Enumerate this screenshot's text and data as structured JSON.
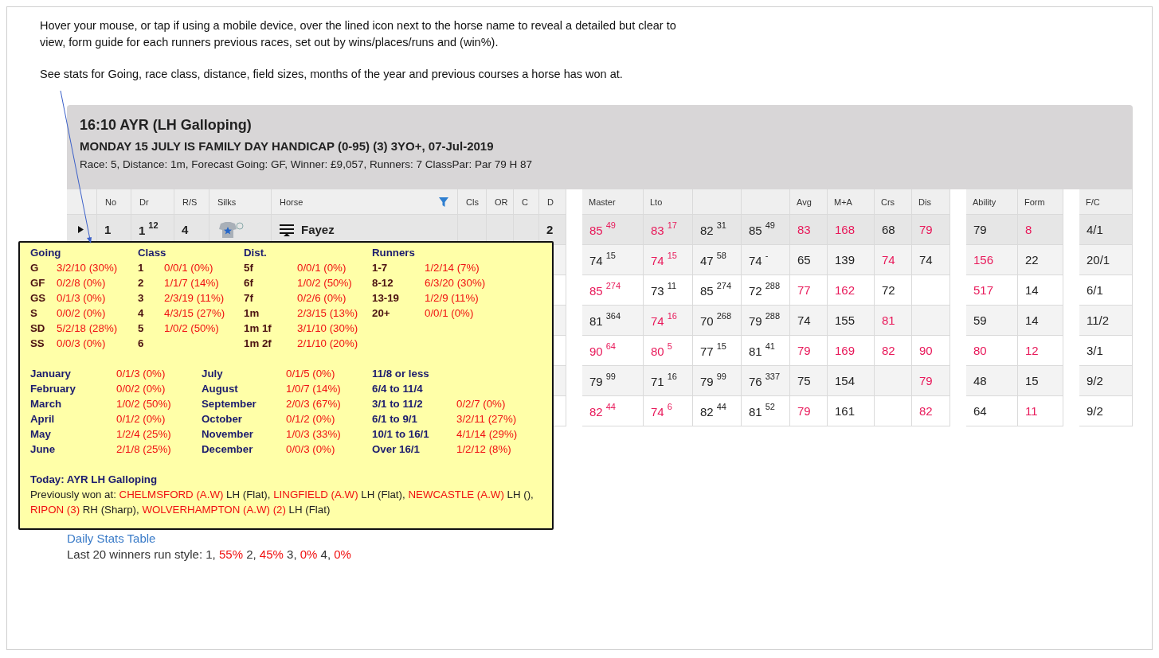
{
  "intro": [
    "Hover your mouse, or tap if using a mobile device, over the lined icon next to the horse name to reveal a detailed but clear to view, form guide for each runners previous races, set out by wins/places/runs and (win%).",
    "See stats for Going, race class, distance, field sizes, months of the year and previous courses a horse has won at."
  ],
  "race": {
    "title": "16:10 AYR (LH Galloping)",
    "name": "MONDAY 15 JULY IS FAMILY DAY HANDICAP (0-95) (3) 3YO+, 07-Jul-2019",
    "details": "Race: 5,  Distance: 1m,  Forecast Going: GF,  Winner: £9,057,  Runners: 7  ClassPar: Par 79 H 87"
  },
  "table": {
    "left_columns": [
      "No",
      "Dr",
      "R/S",
      "Silks",
      "Horse",
      "Cls",
      "OR",
      "C",
      "D"
    ],
    "right_columns": [
      {
        "kind": "label",
        "label": "Master"
      },
      {
        "kind": "label",
        "label": "Lto"
      },
      {
        "kind": "blank"
      },
      {
        "kind": "blank"
      },
      {
        "kind": "label",
        "label": "Avg"
      },
      {
        "kind": "label",
        "label": "M+A"
      },
      {
        "kind": "label",
        "label": "Crs"
      },
      {
        "kind": "label",
        "label": "Dis"
      },
      {
        "kind": "label",
        "label": "Ability"
      },
      {
        "kind": "label",
        "label": "Form"
      },
      {
        "kind": "label",
        "label": "F/C"
      }
    ],
    "rows": [
      {
        "selected": true,
        "runner": {
          "no": "1",
          "dr": "1",
          "dr_sup": "12",
          "rs": "4",
          "horse": "Fayez",
          "d": "2"
        },
        "cells": [
          {
            "kind": "value",
            "value": "85",
            "sup": "49",
            "highlight": true
          },
          {
            "kind": "value",
            "value": "83",
            "sup": "17",
            "highlight": true
          },
          {
            "kind": "value",
            "value": "82",
            "sup": "31",
            "highlight": false
          },
          {
            "kind": "value",
            "value": "85",
            "sup": "49",
            "highlight": false
          },
          {
            "kind": "value",
            "value": "83",
            "highlight": true
          },
          {
            "kind": "value",
            "value": "168",
            "highlight": true
          },
          {
            "kind": "value",
            "value": "68",
            "highlight": false
          },
          {
            "kind": "value",
            "value": "79",
            "highlight": true
          },
          {
            "kind": "value",
            "value": "79",
            "highlight": false
          },
          {
            "kind": "value",
            "value": "8",
            "highlight": true
          },
          {
            "kind": "value",
            "value": "4/1",
            "highlight": false
          }
        ]
      },
      {
        "selected": false,
        "cells": [
          {
            "kind": "value",
            "value": "74",
            "sup": "15",
            "highlight": false
          },
          {
            "kind": "value",
            "value": "74",
            "sup": "15",
            "highlight": true
          },
          {
            "kind": "value",
            "value": "47",
            "sup": "58",
            "highlight": false
          },
          {
            "kind": "value",
            "value": "74",
            "sup": "-",
            "highlight": false
          },
          {
            "kind": "value",
            "value": "65",
            "highlight": false
          },
          {
            "kind": "value",
            "value": "139",
            "highlight": false
          },
          {
            "kind": "value",
            "value": "74",
            "highlight": true
          },
          {
            "kind": "value",
            "value": "74",
            "highlight": false
          },
          {
            "kind": "value",
            "value": "156",
            "highlight": true
          },
          {
            "kind": "value",
            "value": "22",
            "highlight": false
          },
          {
            "kind": "value",
            "value": "20/1",
            "highlight": false
          }
        ]
      },
      {
        "selected": false,
        "cells": [
          {
            "kind": "value",
            "value": "85",
            "sup": "274",
            "highlight": true
          },
          {
            "kind": "value",
            "value": "73",
            "sup": "11",
            "highlight": false
          },
          {
            "kind": "value",
            "value": "85",
            "sup": "274",
            "highlight": false
          },
          {
            "kind": "value",
            "value": "72",
            "sup": "288",
            "highlight": false
          },
          {
            "kind": "value",
            "value": "77",
            "highlight": true
          },
          {
            "kind": "value",
            "value": "162",
            "highlight": true
          },
          {
            "kind": "value",
            "value": "72",
            "highlight": false
          },
          {
            "kind": "empty"
          },
          {
            "kind": "value",
            "value": "517",
            "highlight": true
          },
          {
            "kind": "value",
            "value": "14",
            "highlight": false
          },
          {
            "kind": "value",
            "value": "6/1",
            "highlight": false
          }
        ]
      },
      {
        "selected": false,
        "cells": [
          {
            "kind": "value",
            "value": "81",
            "sup": "364",
            "highlight": false
          },
          {
            "kind": "value",
            "value": "74",
            "sup": "16",
            "highlight": true
          },
          {
            "kind": "value",
            "value": "70",
            "sup": "268",
            "highlight": false
          },
          {
            "kind": "value",
            "value": "79",
            "sup": "288",
            "highlight": false
          },
          {
            "kind": "value",
            "value": "74",
            "highlight": false
          },
          {
            "kind": "value",
            "value": "155",
            "highlight": false
          },
          {
            "kind": "value",
            "value": "81",
            "highlight": true
          },
          {
            "kind": "empty"
          },
          {
            "kind": "value",
            "value": "59",
            "highlight": false
          },
          {
            "kind": "value",
            "value": "14",
            "highlight": false
          },
          {
            "kind": "value",
            "value": "11/2",
            "highlight": false
          }
        ]
      },
      {
        "selected": false,
        "cells": [
          {
            "kind": "value",
            "value": "90",
            "sup": "64",
            "highlight": true
          },
          {
            "kind": "value",
            "value": "80",
            "sup": "5",
            "highlight": true
          },
          {
            "kind": "value",
            "value": "77",
            "sup": "15",
            "highlight": false
          },
          {
            "kind": "value",
            "value": "81",
            "sup": "41",
            "highlight": false
          },
          {
            "kind": "value",
            "value": "79",
            "highlight": true
          },
          {
            "kind": "value",
            "value": "169",
            "highlight": true
          },
          {
            "kind": "value",
            "value": "82",
            "highlight": true
          },
          {
            "kind": "value",
            "value": "90",
            "highlight": true
          },
          {
            "kind": "value",
            "value": "80",
            "highlight": true
          },
          {
            "kind": "value",
            "value": "12",
            "highlight": true
          },
          {
            "kind": "value",
            "value": "3/1",
            "highlight": false
          }
        ]
      },
      {
        "selected": false,
        "cells": [
          {
            "kind": "value",
            "value": "79",
            "sup": "99",
            "highlight": false
          },
          {
            "kind": "value",
            "value": "71",
            "sup": "16",
            "highlight": false
          },
          {
            "kind": "value",
            "value": "79",
            "sup": "99",
            "highlight": false
          },
          {
            "kind": "value",
            "value": "76",
            "sup": "337",
            "highlight": false
          },
          {
            "kind": "value",
            "value": "75",
            "highlight": false
          },
          {
            "kind": "value",
            "value": "154",
            "highlight": false
          },
          {
            "kind": "empty"
          },
          {
            "kind": "value",
            "value": "79",
            "highlight": true
          },
          {
            "kind": "value",
            "value": "48",
            "highlight": false
          },
          {
            "kind": "value",
            "value": "15",
            "highlight": false
          },
          {
            "kind": "value",
            "value": "9/2",
            "highlight": false
          }
        ]
      },
      {
        "selected": false,
        "cells": [
          {
            "kind": "value",
            "value": "82",
            "sup": "44",
            "highlight": true
          },
          {
            "kind": "value",
            "value": "74",
            "sup": "6",
            "highlight": true
          },
          {
            "kind": "value",
            "value": "82",
            "sup": "44",
            "highlight": false
          },
          {
            "kind": "value",
            "value": "81",
            "sup": "52",
            "highlight": false
          },
          {
            "kind": "value",
            "value": "79",
            "highlight": true
          },
          {
            "kind": "value",
            "value": "161",
            "highlight": false
          },
          {
            "kind": "empty"
          },
          {
            "kind": "value",
            "value": "82",
            "highlight": true
          },
          {
            "kind": "value",
            "value": "64",
            "highlight": false
          },
          {
            "kind": "value",
            "value": "11",
            "highlight": true
          },
          {
            "kind": "value",
            "value": "9/2",
            "highlight": false
          }
        ]
      }
    ]
  },
  "form_guide": {
    "top_groups": [
      {
        "heading": "Going",
        "rows": [
          {
            "label": "G",
            "value": "3/2/10 (30%)"
          },
          {
            "label": "GF",
            "value": "0/2/8 (0%)"
          },
          {
            "label": "GS",
            "value": "0/1/3 (0%)"
          },
          {
            "label": "S",
            "value": "0/0/2 (0%)"
          },
          {
            "label": "SD",
            "value": "5/2/18 (28%)"
          },
          {
            "label": "SS",
            "value": "0/0/3 (0%)"
          }
        ]
      },
      {
        "heading": "Class",
        "rows": [
          {
            "label": "1",
            "value": "0/0/1 (0%)"
          },
          {
            "label": "2",
            "value": "1/1/7 (14%)"
          },
          {
            "label": "3",
            "value": "2/3/19 (11%)"
          },
          {
            "label": "4",
            "value": "4/3/15 (27%)"
          },
          {
            "label": "5",
            "value": "1/0/2 (50%)"
          },
          {
            "label": "6"
          }
        ]
      },
      {
        "heading": "Dist.",
        "rows": [
          {
            "label": "5f",
            "value": "0/0/1 (0%)"
          },
          {
            "label": "6f",
            "value": "1/0/2 (50%)"
          },
          {
            "label": "7f",
            "value": "0/2/6 (0%)"
          },
          {
            "label": "1m",
            "value": "2/3/15 (13%)"
          },
          {
            "label": "1m 1f",
            "value": "3/1/10 (30%)"
          },
          {
            "label": "1m 2f",
            "value": "2/1/10 (20%)"
          }
        ]
      },
      {
        "heading": "Runners",
        "rows": [
          {
            "label": "1-7",
            "value": "1/2/14 (7%)"
          },
          {
            "label": "8-12",
            "value": "6/3/20 (30%)"
          },
          {
            "label": "13-19",
            "value": "1/2/9 (11%)"
          },
          {
            "label": "20+",
            "value": "0/0/1 (0%)"
          }
        ]
      }
    ],
    "bottom_groups": [
      {
        "rows": [
          {
            "label": "January",
            "value": "0/1/3 (0%)"
          },
          {
            "label": "February",
            "value": "0/0/2 (0%)"
          },
          {
            "label": "March",
            "value": "1/0/2 (50%)"
          },
          {
            "label": "April",
            "value": "0/1/2 (0%)"
          },
          {
            "label": "May",
            "value": "1/2/4 (25%)"
          },
          {
            "label": "June",
            "value": "2/1/8 (25%)"
          }
        ]
      },
      {
        "rows": [
          {
            "label": "July",
            "value": "0/1/5 (0%)"
          },
          {
            "label": "August",
            "value": "1/0/7 (14%)"
          },
          {
            "label": "September",
            "value": "2/0/3 (67%)"
          },
          {
            "label": "October",
            "value": "0/1/2 (0%)"
          },
          {
            "label": "November",
            "value": "1/0/3 (33%)"
          },
          {
            "label": "December",
            "value": "0/0/3 (0%)"
          }
        ]
      },
      {
        "rows": [
          {
            "label": "11/8 or less"
          },
          {
            "label": "6/4 to 11/4"
          },
          {
            "label": "3/1 to 11/2",
            "value": "0/2/7 (0%)"
          },
          {
            "label": "6/1 to 9/1",
            "value": "3/2/11 (27%)"
          },
          {
            "label": "10/1 to 16/1",
            "value": "4/1/14 (29%)"
          },
          {
            "label": "Over 16/1",
            "value": "1/2/12 (8%)"
          }
        ]
      }
    ],
    "today": "Today: AYR LH Galloping",
    "previously": {
      "label": "Previously won at:",
      "courses": [
        {
          "name": "CHELMSFORD (A.W)",
          "detail": "LH (Flat),"
        },
        {
          "name": "LINGFIELD (A.W)",
          "detail": "LH (Flat),"
        },
        {
          "name": "NEWCASTLE (A.W)",
          "detail": "LH (),"
        },
        {
          "name": "RIPON (3)",
          "detail": "RH (Sharp),"
        },
        {
          "name": "WOLVERHAMPTON (A.W) (2)",
          "detail": "LH (Flat)"
        }
      ]
    }
  },
  "footer": {
    "link": "Daily Stats Table",
    "run_style": {
      "label": "Last 20 winners run style:",
      "items": [
        {
          "label": "1,",
          "value": "55%"
        },
        {
          "label": "2,",
          "value": "45%"
        },
        {
          "label": "3,",
          "value": "0%"
        },
        {
          "label": "4,",
          "value": "0%"
        }
      ]
    }
  }
}
